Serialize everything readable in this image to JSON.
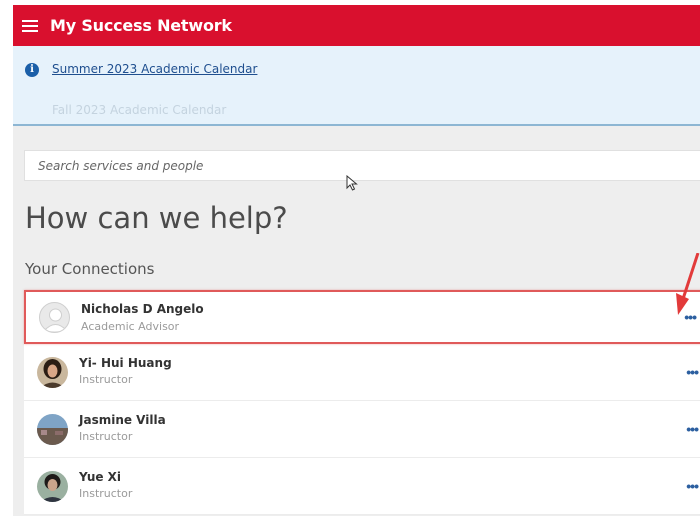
{
  "header": {
    "title": "My Success Network",
    "menu_icon": "hamburger-menu-icon"
  },
  "banner": {
    "info_icon": "info-icon",
    "info_glyph": "i",
    "links": [
      "Summer 2023 Academic Calendar",
      "Fall 2023 Academic Calendar"
    ]
  },
  "search": {
    "placeholder": "Search services and people"
  },
  "main": {
    "heading": "How can we help?",
    "connections_label": "Your Connections"
  },
  "connections": [
    {
      "name": "Nicholas D Angelo",
      "role": "Academic Advisor",
      "more": "•••",
      "highlighted": true
    },
    {
      "name": "Yi- Hui Huang",
      "role": "Instructor",
      "more": "•••"
    },
    {
      "name": "Jasmine Villa",
      "role": "Instructor",
      "more": "•••"
    },
    {
      "name": "Yue Xi",
      "role": "Instructor",
      "more": "•••"
    }
  ],
  "colors": {
    "brand": "#d9102e",
    "banner_bg": "#e6f2fb",
    "link": "#1f4f8f",
    "highlight_border": "#e05a5a",
    "more_dots": "#2c5fa0"
  }
}
